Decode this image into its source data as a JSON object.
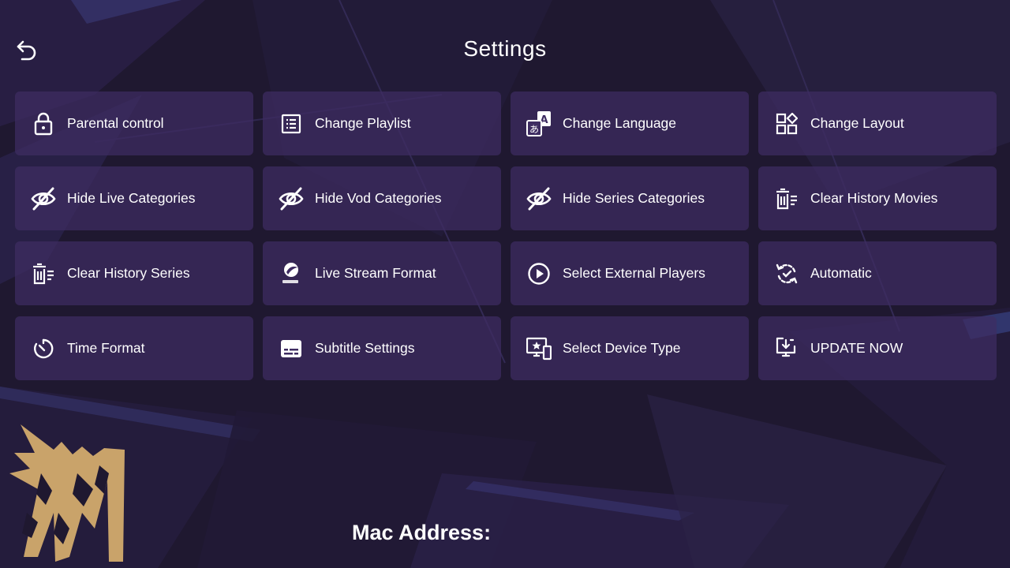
{
  "header": {
    "title": "Settings",
    "back_icon": "back-arrow-icon"
  },
  "tiles": [
    {
      "label": "Parental control",
      "icon": "lock-icon"
    },
    {
      "label": "Change Playlist",
      "icon": "playlist-icon"
    },
    {
      "label": "Change Language",
      "icon": "translate-icon"
    },
    {
      "label": "Change Layout",
      "icon": "layout-icon"
    },
    {
      "label": "Hide Live Categories",
      "icon": "eye-off-icon"
    },
    {
      "label": "Hide Vod Categories",
      "icon": "eye-off-icon"
    },
    {
      "label": "Hide Series Categories",
      "icon": "eye-off-icon"
    },
    {
      "label": "Clear History Movies",
      "icon": "trash-list-icon"
    },
    {
      "label": "Clear History Series",
      "icon": "trash-list-icon"
    },
    {
      "label": "Live Stream Format",
      "icon": "stream-format-logo-icon"
    },
    {
      "label": "Select External Players",
      "icon": "play-circle-icon"
    },
    {
      "label": "Automatic",
      "icon": "auto-refresh-icon"
    },
    {
      "label": "Time Format",
      "icon": "timer-icon"
    },
    {
      "label": "Subtitle Settings",
      "icon": "subtitles-icon"
    },
    {
      "label": "Select Device Type",
      "icon": "devices-icon"
    },
    {
      "label": "UPDATE NOW",
      "icon": "download-update-icon"
    }
  ],
  "footer": {
    "mac_label": "Mac Address:"
  },
  "colors": {
    "background": "#1f1830",
    "tile": "#3e2c62",
    "text": "#ffffff",
    "logo_gold": "#c9a36a"
  }
}
